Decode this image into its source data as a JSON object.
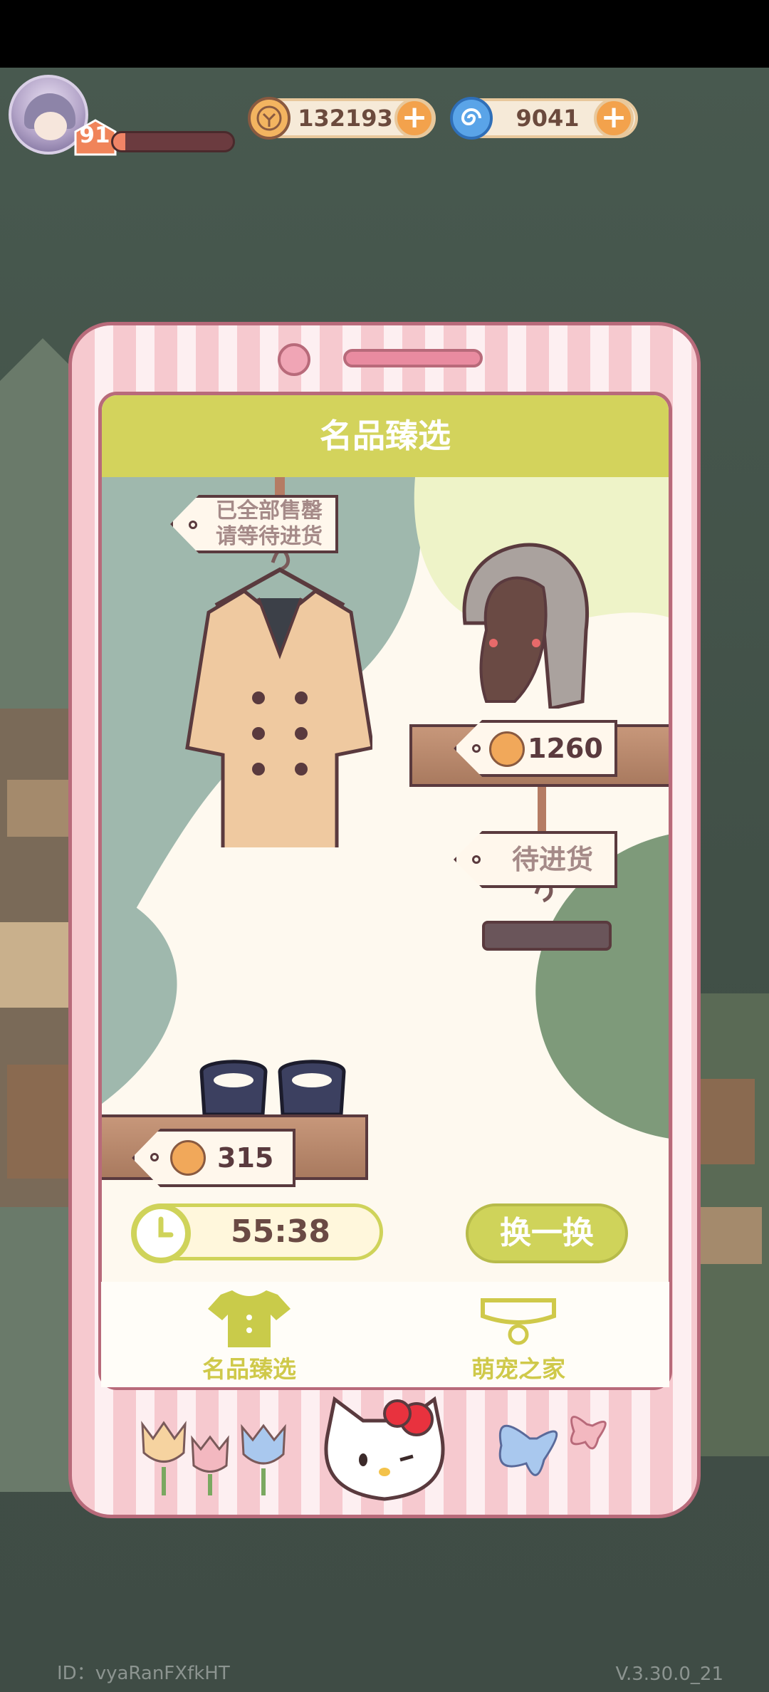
{
  "hud": {
    "level": "91",
    "xp_fraction": 0.1,
    "coins": "132193",
    "gems": "9041"
  },
  "shop": {
    "title": "名品臻选",
    "coat_tag_line1": "已全部售罄",
    "coat_tag_line2": "请等待进货",
    "wig_price": "1260",
    "hanger_tag": "待进货",
    "shoes_price": "315",
    "timer": "55:38",
    "swap_label": "换一换"
  },
  "tabs": [
    {
      "label": "名品臻选",
      "icon": "shirt-icon"
    },
    {
      "label": "萌宠之家",
      "icon": "pet-collar-icon"
    }
  ],
  "footer": {
    "id": "ID：vyaRanFXfkHT",
    "version": "V.3.30.0_21"
  },
  "colors": {
    "header": "#d3d35c",
    "frame": "#f6c9cf",
    "accent": "#cfd35a"
  }
}
